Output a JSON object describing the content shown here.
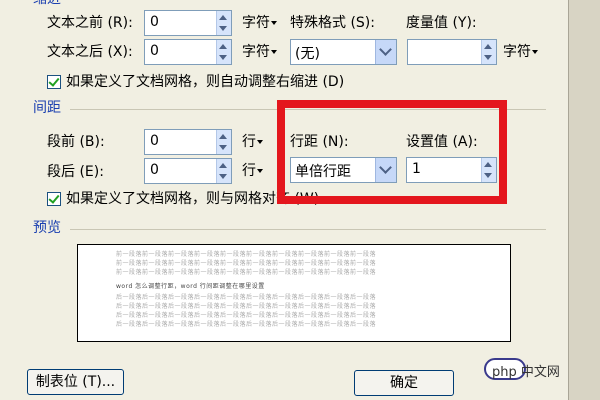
{
  "indent": {
    "section_title": "缩进",
    "before_text": {
      "label": "文本之前 (R):",
      "value": "0",
      "unit": "字符"
    },
    "after_text": {
      "label": "文本之后 (X):",
      "value": "0",
      "unit": "字符"
    },
    "special_format": {
      "label": "特殊格式 (S):",
      "value": "(无)"
    },
    "measure": {
      "label": "度量值 (Y):",
      "value": "",
      "unit": "字符"
    },
    "auto_adjust_checkbox": {
      "label": "如果定义了文档网格，则自动调整右缩进 (D)",
      "checked": true
    }
  },
  "spacing": {
    "section_title": "间距",
    "before": {
      "label": "段前 (B):",
      "value": "0",
      "unit": "行"
    },
    "after": {
      "label": "段后 (E):",
      "value": "0",
      "unit": "行"
    },
    "line_spacing": {
      "label": "行距 (N):",
      "value": "单倍行距"
    },
    "set_value": {
      "label": "设置值 (A):",
      "value": "1"
    },
    "grid_align_checkbox": {
      "label": "如果定义了文档网格，则与网格对齐 (W)",
      "checked": true
    }
  },
  "preview": {
    "section_title": "预览",
    "before_text": "前一段落前一段落前一段落前一段落前一段落前一段落前一段落前一段落前一段落前一段落",
    "current_text": "word 怎么调整行距，word 行间距调整在哪里设置",
    "after_text": "后一段落后一段落后一段落后一段落后一段落后一段落后一段落后一段落后一段落后一段落"
  },
  "buttons": {
    "tabs": "制表位 (T)...",
    "ok": "确定"
  },
  "watermark": "php 中文网",
  "colors": {
    "highlight_box": "#e4161d",
    "section_title": "#1a3fb0"
  }
}
